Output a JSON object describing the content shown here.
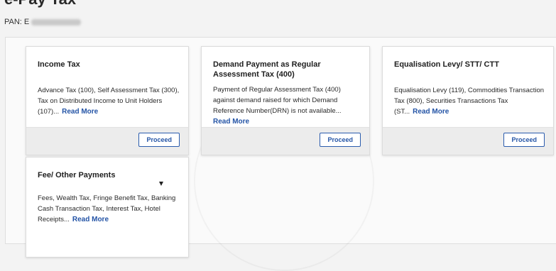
{
  "page": {
    "title": "e-Pay Tax",
    "pan_label": "PAN: E"
  },
  "cards": [
    {
      "title": "Income Tax",
      "description": "Advance Tax (100), Self Assessment Tax (300), Tax on Distributed Income to Unit Holders (107)...",
      "read_more": "Read More",
      "button": "Proceed"
    },
    {
      "title": "Demand Payment as Regular Assessment Tax (400)",
      "description": "Payment of Regular Assessment Tax (400) against demand raised for which Demand Reference Number(DRN) is not available...",
      "read_more": "Read More",
      "button": "Proceed"
    },
    {
      "title": "Equalisation Levy/ STT/ CTT",
      "description": "Equalisation Levy (119), Commodities Transaction Tax (800), Securities Transactions Tax (ST...",
      "read_more": "Read More",
      "button": "Proceed"
    },
    {
      "title": "Fee/ Other Payments",
      "description": "Fees, Wealth Tax, Fringe Benefit Tax, Banking Cash Transaction Tax, Interest Tax, Hotel Receipts...",
      "read_more": "Read More"
    }
  ],
  "colors": {
    "accent": "#2454a6",
    "footer_bg": "#ececec"
  },
  "icons": {
    "cursor": "mouse-pointer-icon"
  }
}
